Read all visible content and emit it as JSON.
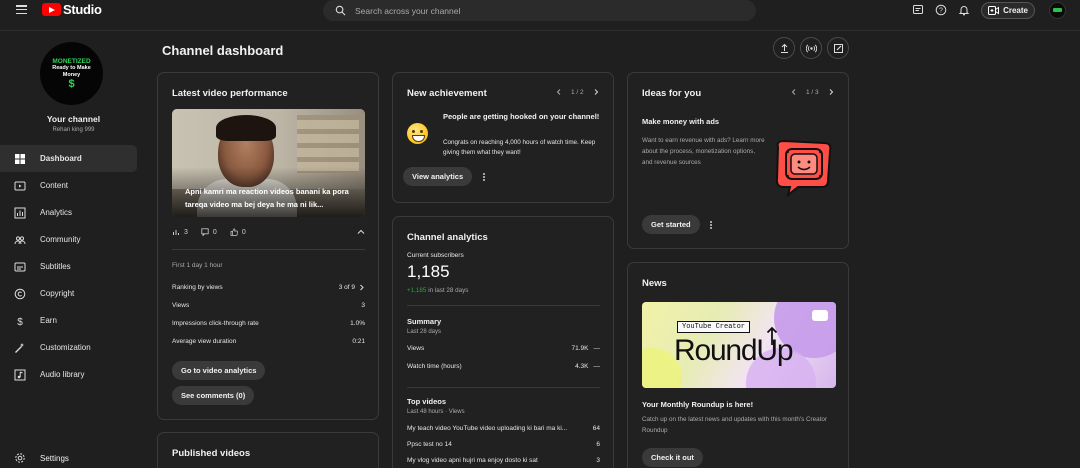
{
  "app": {
    "brand": "Studio",
    "search_placeholder": "Search across your channel",
    "create_label": "Create"
  },
  "sidebar": {
    "avatar": {
      "line1": "MONETIZED",
      "line2": "Ready to Make Money",
      "symbol": "$"
    },
    "channel_title": "Your channel",
    "channel_name": "Rehan king 999",
    "items": [
      {
        "label": "Dashboard",
        "icon": "dashboard-icon",
        "active": true
      },
      {
        "label": "Content",
        "icon": "content-icon"
      },
      {
        "label": "Analytics",
        "icon": "analytics-icon"
      },
      {
        "label": "Community",
        "icon": "community-icon"
      },
      {
        "label": "Subtitles",
        "icon": "subtitles-icon"
      },
      {
        "label": "Copyright",
        "icon": "copyright-icon"
      },
      {
        "label": "Earn",
        "icon": "earn-icon"
      },
      {
        "label": "Customization",
        "icon": "customization-icon"
      },
      {
        "label": "Audio library",
        "icon": "audio-library-icon"
      }
    ],
    "settings_label": "Settings"
  },
  "page": {
    "title": "Channel dashboard"
  },
  "latest_video": {
    "title": "Latest video performance",
    "caption": "Apni kamri ma reaction videos banani ka pora tareqa video ma bej deya he ma ni lik...",
    "views_count": "3",
    "comments_count": "0",
    "likes_count": "0",
    "period": "First 1 day 1 hour",
    "rows": [
      {
        "label": "Ranking by views",
        "value": "3 of 9"
      },
      {
        "label": "Views",
        "value": "3"
      },
      {
        "label": "Impressions click-through rate",
        "value": "1.0%"
      },
      {
        "label": "Average view duration",
        "value": "0:21"
      }
    ],
    "btn_analytics": "Go to video analytics",
    "btn_comments": "See comments (0)"
  },
  "published": {
    "title": "Published videos"
  },
  "achievement": {
    "title": "New achievement",
    "pager": "1 / 2",
    "headline": "People are getting hooked on your channel!",
    "body": "Congrats on reaching 4,000 hours of watch time. Keep giving them what they want!",
    "button": "View analytics"
  },
  "analytics": {
    "title": "Channel analytics",
    "subs_label": "Current subscribers",
    "subs_value": "1,185",
    "subs_delta": "+1,185",
    "subs_delta_suffix": "in last 28 days",
    "summary_title": "Summary",
    "summary_period": "Last 28 days",
    "summary_rows": [
      {
        "label": "Views",
        "value": "71.9K",
        "trend": "—"
      },
      {
        "label": "Watch time (hours)",
        "value": "4.3K",
        "trend": "—"
      }
    ],
    "top_title": "Top videos",
    "top_period": "Last 48 hours · Views",
    "top_rows": [
      {
        "label": "My teach video YouTube video uploading ki bari ma ki...",
        "value": "64"
      },
      {
        "label": "Ppsc test no 14",
        "value": "6"
      },
      {
        "label": "My vlog video apni hujri ma enjoy dosto ki sat",
        "value": "3"
      }
    ]
  },
  "ideas": {
    "title": "Ideas for you",
    "pager": "1 / 3",
    "heading": "Make money with ads",
    "body": "Want to earn revenue with ads? Learn more about the process, monetization options, and revenue sources",
    "button": "Get started"
  },
  "news": {
    "title": "News",
    "img_tag": "YouTube Creator",
    "img_big": "RoundUp",
    "heading": "Your Monthly Roundup is here!",
    "body": "Catch up on the latest news and updates with this month's Creator Roundup",
    "button": "Check it out"
  },
  "colors": {
    "accent_red": "#ff0000",
    "positive_green": "#2ba640",
    "monetized_green": "#2fd35a"
  }
}
